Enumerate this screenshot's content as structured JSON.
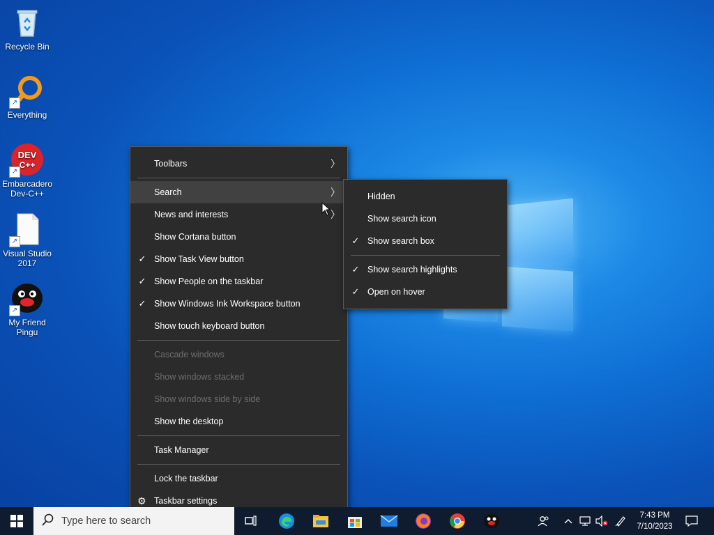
{
  "desktop": {
    "icons": [
      {
        "label": "Recycle Bin",
        "icon": "recycle-bin-icon"
      },
      {
        "label": "Everything",
        "icon": "everything-search-icon"
      },
      {
        "label": "Embarcadero Dev-C++",
        "icon": "dev-cpp-icon",
        "badge": "DEV C++"
      },
      {
        "label": "Visual Studio 2017",
        "icon": "blank-file-icon"
      },
      {
        "label": "My Friend Pingu",
        "icon": "pingu-icon"
      }
    ]
  },
  "context_menu": {
    "items": [
      {
        "label": "Toolbars",
        "checked": false,
        "submenu": true
      },
      {
        "label": "Search",
        "checked": false,
        "submenu": true,
        "highlighted": true
      },
      {
        "label": "News and interests",
        "checked": false,
        "submenu": true
      },
      {
        "label": "Show Cortana button",
        "checked": false
      },
      {
        "label": "Show Task View button",
        "checked": true
      },
      {
        "label": "Show People on the taskbar",
        "checked": true
      },
      {
        "label": "Show Windows Ink Workspace button",
        "checked": true
      },
      {
        "label": "Show touch keyboard button",
        "checked": false
      },
      {
        "label": "Cascade windows",
        "disabled": true
      },
      {
        "label": "Show windows stacked",
        "disabled": true
      },
      {
        "label": "Show windows side by side",
        "disabled": true
      },
      {
        "label": "Show the desktop"
      },
      {
        "label": "Task Manager"
      },
      {
        "label": "Lock the taskbar"
      },
      {
        "label": "Taskbar settings",
        "icon": "gear-icon"
      }
    ]
  },
  "search_submenu": {
    "items": [
      {
        "label": "Hidden",
        "checked": false
      },
      {
        "label": "Show search icon",
        "checked": false
      },
      {
        "label": "Show search box",
        "checked": true
      },
      {
        "label": "Show search highlights",
        "checked": true
      },
      {
        "label": "Open on hover",
        "checked": true
      }
    ]
  },
  "glyphs": {
    "check": "✓",
    "arrow": "›",
    "gear": "⚙"
  },
  "taskbar": {
    "search_placeholder": "Type here to search",
    "apps": [
      "task-view-icon",
      "edge-icon",
      "file-explorer-icon",
      "store-icon",
      "mail-icon",
      "firefox-icon",
      "chrome-icon",
      "pingu-icon"
    ],
    "clock": {
      "time": "7:43 PM",
      "date": "7/10/2023"
    }
  },
  "colors": {
    "menu_bg": "#2b2b2b",
    "menu_hover": "#414141",
    "disabled_text": "#6d6d6d",
    "taskbar_bg": "#0f1b2e"
  }
}
